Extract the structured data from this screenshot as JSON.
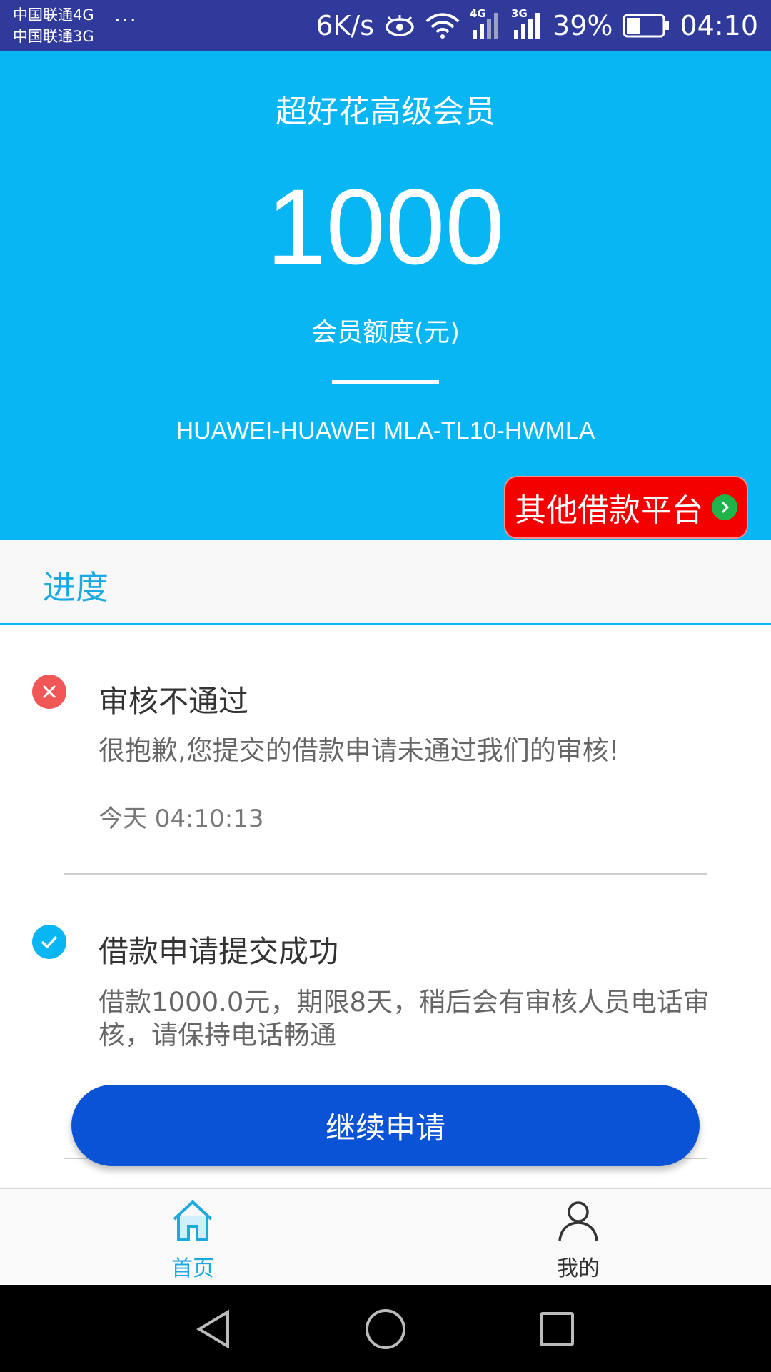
{
  "status_bar": {
    "carrier1": "中国联通4G",
    "carrier2": "中国联通3G",
    "more": "···",
    "speed": "6K/s",
    "net1": "4G",
    "net2": "3G",
    "battery": "39%",
    "battery_level": 0.39,
    "time": "04:10",
    "icons": [
      "eye-icon",
      "wifi-icon",
      "signal-icon",
      "battery-icon"
    ]
  },
  "hero": {
    "title": "超好花高级会员",
    "amount": "1000",
    "caption": "会员额度(元)",
    "device": "HUAWEI-HUAWEI MLA-TL10-HWMLA",
    "platform_button": "其他借款平台"
  },
  "progress": {
    "header": "进度",
    "steps": [
      {
        "status": "rejected",
        "title": "审核不通过",
        "desc": "很抱歉,您提交的借款申请未通过我们的审核!",
        "time": "今天 04:10:13"
      },
      {
        "status": "success",
        "title": "借款申请提交成功",
        "desc": "借款1000.0元，期限8天，稍后会有审核人员电话审核，请保持电话畅通"
      }
    ]
  },
  "continue_button": "继续申请",
  "bottom_nav": {
    "home": "首页",
    "mine": "我的"
  },
  "colors": {
    "primary": "#07b6f2",
    "button": "#0a52d6",
    "danger": "#f40000",
    "error_icon": "#f25757"
  }
}
